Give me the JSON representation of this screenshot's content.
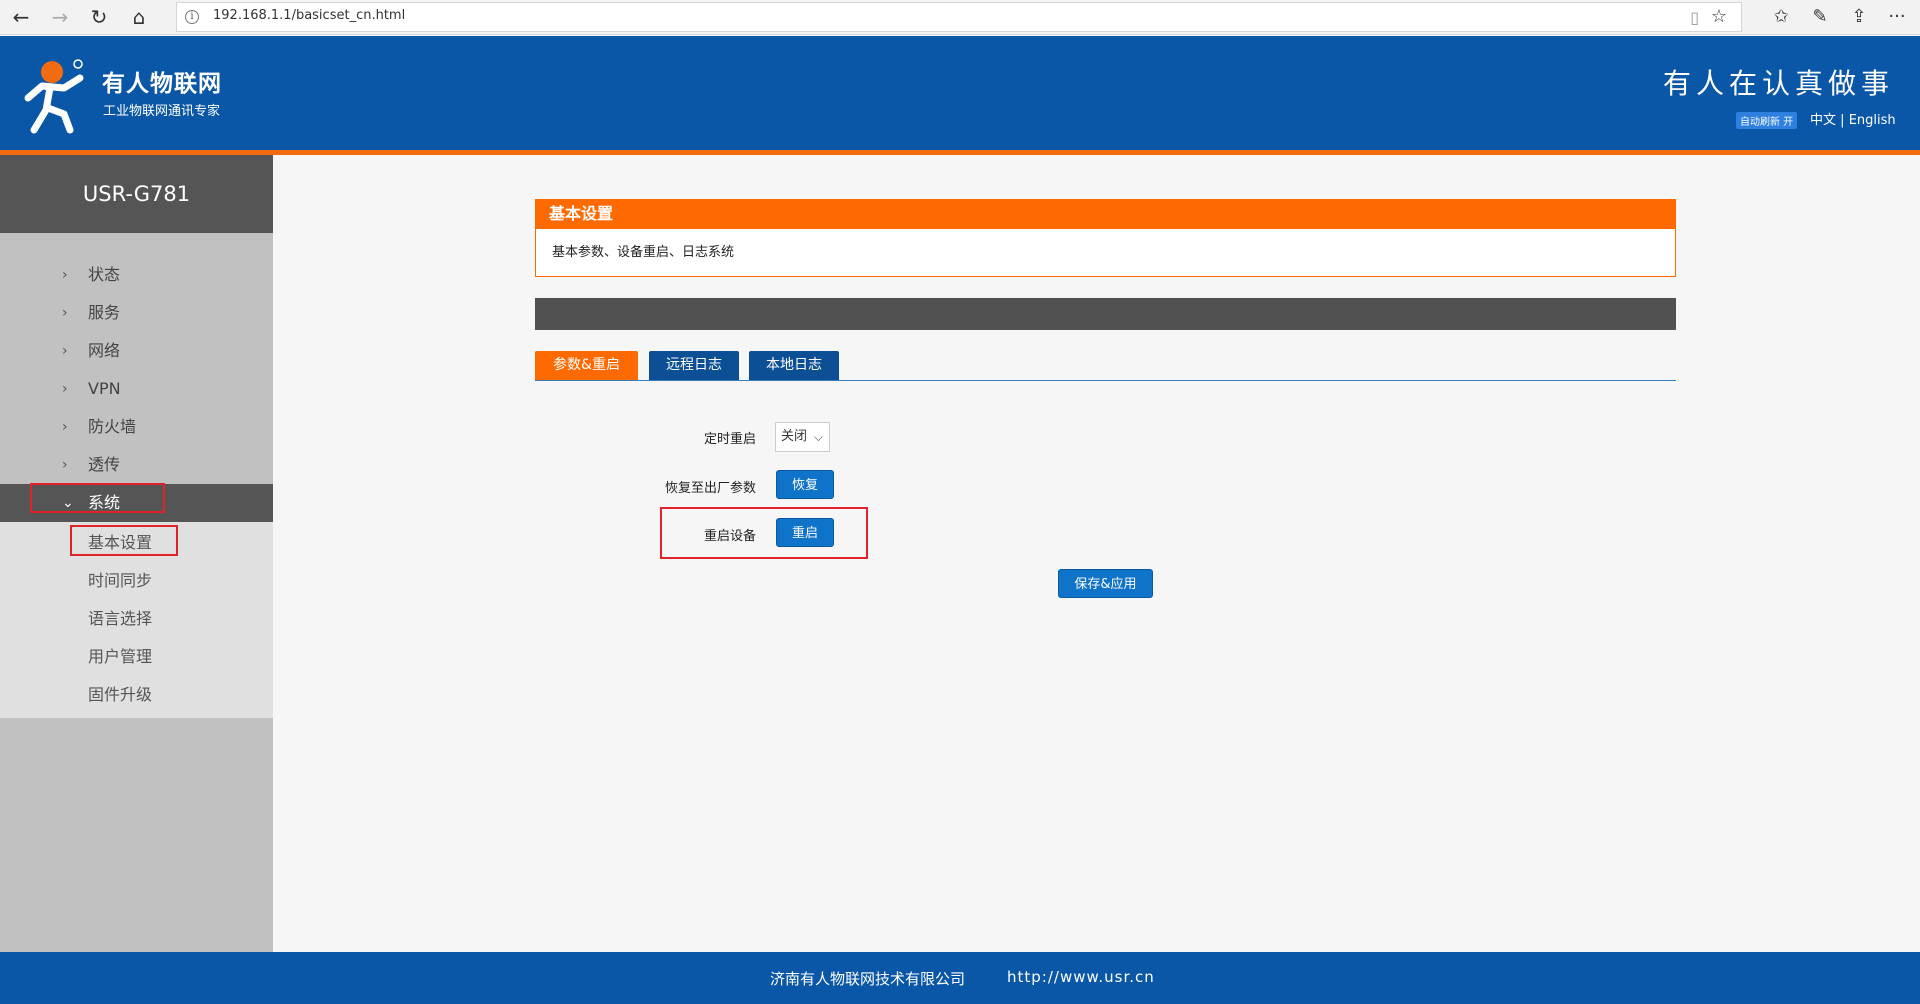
{
  "browser": {
    "back_icon": "←",
    "forward_icon": "→",
    "refresh_icon": "↻",
    "home_icon": "⌂",
    "url": "192.168.1.1/basicset_cn.html",
    "info_icon": "i",
    "reader_icon": "▯",
    "star_icon": "☆",
    "favorites_icon": "✩",
    "pen_icon": "✎",
    "share_icon": "⇪",
    "more_icon": "···"
  },
  "header": {
    "brand": "有人物联网",
    "brand_sub": "工业物联网通讯专家",
    "slogan": "有人在认真做事",
    "auto_refresh": "自动刷新 开",
    "lang_cn": "中文",
    "lang_sep": "|",
    "lang_en": "English",
    "brand_color": "#0b57a7",
    "accent_color": "#ff6a00"
  },
  "sidebar": {
    "model": "USR-G781",
    "items": [
      {
        "label": "状态",
        "chevron": "›"
      },
      {
        "label": "服务",
        "chevron": "›"
      },
      {
        "label": "网络",
        "chevron": "›"
      },
      {
        "label": "VPN",
        "chevron": "›"
      },
      {
        "label": "防火墙",
        "chevron": "›"
      },
      {
        "label": "透传",
        "chevron": "›"
      },
      {
        "label": "系统",
        "chevron": "⌄"
      }
    ],
    "subitems": [
      {
        "label": "基本设置"
      },
      {
        "label": "时间同步"
      },
      {
        "label": "语言选择"
      },
      {
        "label": "用户管理"
      },
      {
        "label": "固件升级"
      }
    ]
  },
  "main": {
    "panel_title": "基本设置",
    "panel_desc": "基本参数、设备重启、日志系统",
    "tabs": [
      {
        "label": "参数&重启"
      },
      {
        "label": "远程日志"
      },
      {
        "label": "本地日志"
      }
    ],
    "form": {
      "reboot_timer_label": "定时重启",
      "reboot_timer_value": "关闭",
      "reboot_timer_caret": "⌵",
      "restore_label": "恢复至出厂参数",
      "restore_button": "恢复",
      "reboot_label": "重启设备",
      "reboot_button": "重启",
      "save_button": "保存&应用"
    }
  },
  "footer": {
    "company": "济南有人物联网技术有限公司",
    "url": "http://www.usr.cn"
  }
}
